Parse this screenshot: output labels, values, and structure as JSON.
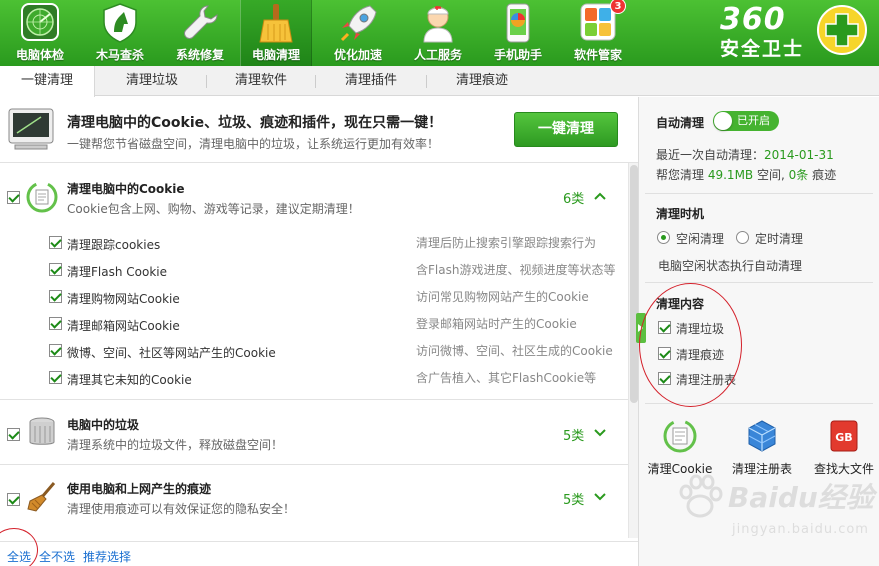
{
  "nav": {
    "items": [
      {
        "label": "电脑体检",
        "icon": "radar-icon"
      },
      {
        "label": "木马查杀",
        "icon": "horse-shield-icon"
      },
      {
        "label": "系统修复",
        "icon": "wrench-icon"
      },
      {
        "label": "电脑清理",
        "icon": "broom-icon"
      },
      {
        "label": "优化加速",
        "icon": "rocket-icon"
      },
      {
        "label": "人工服务",
        "icon": "doctor-icon"
      },
      {
        "label": "手机助手",
        "icon": "phone-icon"
      },
      {
        "label": "软件管家",
        "icon": "apps-icon",
        "badge": "3"
      }
    ],
    "active_index": 3
  },
  "logo": {
    "number": "360",
    "name": "安全卫士"
  },
  "subtabs": [
    "一键清理",
    "清理垃圾",
    "清理软件",
    "清理插件",
    "清理痕迹"
  ],
  "hero": {
    "title": "清理电脑中的Cookie、垃圾、痕迹和插件，现在只需一键！",
    "subtitle": "一键帮您节省磁盘空间，清理电脑中的垃圾，让系统运行更加有效率！",
    "button": "一键清理"
  },
  "groups": {
    "cookie": {
      "title": "清理电脑中的Cookie",
      "desc": "Cookie包含上网、购物、游戏等记录，建议定期清理！",
      "count": "6类",
      "items": [
        {
          "label": "清理跟踪cookies",
          "desc": "清理后防止搜索引擎跟踪搜索行为"
        },
        {
          "label": "清理Flash Cookie",
          "desc": "含Flash游戏进度、视频进度等状态等"
        },
        {
          "label": "清理购物网站Cookie",
          "desc": "访问常见购物网站产生的Cookie"
        },
        {
          "label": "清理邮箱网站Cookie",
          "desc": "登录邮箱网站时产生的Cookie"
        },
        {
          "label": "微博、空间、社区等网站产生的Cookie",
          "desc": "访问微博、空间、社区生成的Cookie"
        },
        {
          "label": "清理其它未知的Cookie",
          "desc": "含广告植入、其它FlashCookie等"
        }
      ]
    },
    "junk": {
      "title": "电脑中的垃圾",
      "desc": "清理系统中的垃圾文件，释放磁盘空间！",
      "count": "5类"
    },
    "traces": {
      "title": "使用电脑和上网产生的痕迹",
      "desc": "清理使用痕迹可以有效保证您的隐私安全！",
      "count": "5类"
    }
  },
  "footer": {
    "select_all": "全选",
    "select_none": "全不选",
    "recommended": "推荐选择"
  },
  "right": {
    "auto_clean_label": "自动清理",
    "toggle_text": "已开启",
    "last_auto_prefix": "最近一次自动清理：",
    "last_auto_date": "2014-01-31",
    "saved_prefix": "帮您清理",
    "saved_size": "49.1MB",
    "saved_mid": "空间,",
    "saved_count": "0条",
    "saved_suffix": "痕迹",
    "timing_title": "清理时机",
    "radio_idle": "空闲清理",
    "radio_timed": "定时清理",
    "timing_desc": "电脑空闲状态执行自动清理",
    "content_title": "清理内容",
    "content_items": [
      "清理垃圾",
      "清理痕迹",
      "清理注册表"
    ],
    "tools": [
      {
        "label": "清理Cookie",
        "icon": "cookie-icon"
      },
      {
        "label": "清理注册表",
        "icon": "registry-cubes-icon"
      },
      {
        "label": "查找大文件",
        "icon": "gb-file-icon"
      }
    ]
  },
  "watermark": {
    "text": "Baidu经验",
    "sub": "jingyan.baidu.com"
  },
  "colors": {
    "brand_green": "#2a9a1e",
    "header_green": "#4cc133",
    "link_blue": "#1a6fd0",
    "annotation_red": "#d4202a"
  }
}
